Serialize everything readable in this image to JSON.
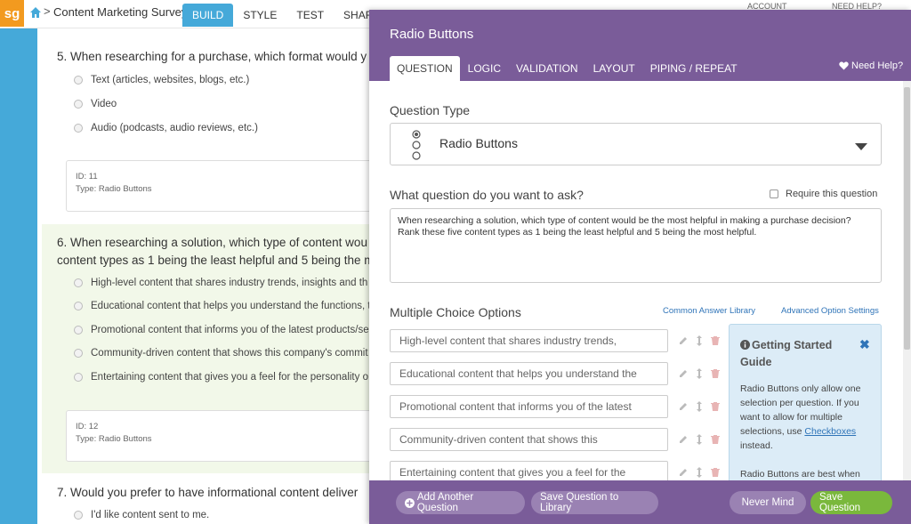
{
  "topbar": {
    "logo": "sg",
    "breadcrumb_sep": ">",
    "survey_title": "Content Marketing Survey",
    "tabs": [
      {
        "label": "BUILD",
        "active": true
      },
      {
        "label": "STYLE",
        "active": false
      },
      {
        "label": "TEST",
        "active": false
      },
      {
        "label": "SHARE",
        "active": false
      }
    ],
    "right1": "ACCOUNT",
    "right2": "NEED HELP?"
  },
  "survey": {
    "q5": {
      "title": "5. When researching for a purchase, which format would y",
      "options": [
        "Text (articles, websites, blogs, etc.)",
        "Video",
        "Audio (podcasts, audio reviews, etc.)"
      ],
      "id_text": "ID: 11",
      "type_text": "Type: Radio Buttons"
    },
    "q6": {
      "title_line1": "6. When researching a solution, which type of content wou",
      "title_line2": "content types as 1 being the least helpful and 5 being the m",
      "options": [
        "High-level content that shares industry trends, insights and th",
        "Educational content that helps you understand the functions, t",
        "Promotional content that informs you of the latest products/se",
        "Community-driven content that shows this company's commit",
        "Entertaining content that gives you a feel for the personality o"
      ],
      "id_text": "ID: 12",
      "type_text": "Type: Radio Buttons"
    },
    "q7": {
      "title": "7. Would you prefer to have informational content deliver",
      "options": [
        "I'd like content sent to me."
      ]
    }
  },
  "panel": {
    "title": "Radio Buttons",
    "tabs": [
      {
        "label": "QUESTION",
        "active": true
      },
      {
        "label": "LOGIC",
        "active": false
      },
      {
        "label": "VALIDATION",
        "active": false
      },
      {
        "label": "LAYOUT",
        "active": false
      },
      {
        "label": "PIPING / REPEAT",
        "active": false
      }
    ],
    "need_help": "Need Help?",
    "question_type_label": "Question Type",
    "question_type_value": "Radio Buttons",
    "ask_label": "What question do you want to ask?",
    "require_label": "Require this question",
    "question_text": "When researching a solution, which type of content would be the most helpful in making a purchase decision? Rank these five content types as 1 being the least helpful and 5 being the most helpful.",
    "mc_label": "Multiple Choice Options",
    "common_library": "Common Answer Library",
    "advanced_settings": "Advanced Option Settings",
    "options": [
      "High-level content that shares industry trends,",
      "Educational content that helps you understand the",
      "Promotional content that informs you of the latest",
      "Community-driven content that shows this",
      "Entertaining content that gives you a feel for the"
    ],
    "guide": {
      "title": "Getting Started Guide",
      "close": "✖",
      "body_pre": "Radio Buttons only allow one selection per question. If you want to allow for multiple selections, use",
      "body_link": "Checkboxes",
      "body_post": "instead.",
      "body2": "Radio Buttons are best when"
    },
    "footer": {
      "add_another": "Add Another Question",
      "save_library": "Save Question to Library",
      "never_mind": "Never Mind",
      "save_question": "Save Question"
    }
  },
  "colors": {
    "brand_orange": "#f29a1f",
    "build_blue": "#45a9d9",
    "panel_purple": "#7a5c99",
    "save_green": "#7ab83c"
  }
}
